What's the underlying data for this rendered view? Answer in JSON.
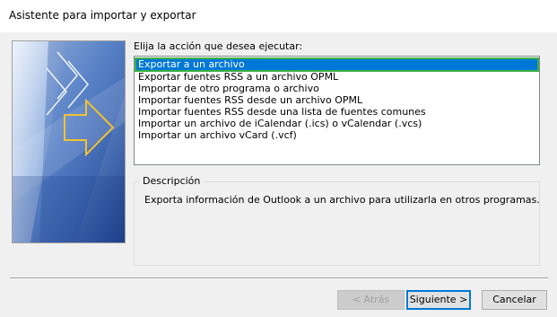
{
  "window": {
    "title": "Asistente para importar y exportar"
  },
  "prompt": "Elija la acción que desea ejecutar:",
  "actions": [
    {
      "label": "Exportar a un archivo",
      "selected": true
    },
    {
      "label": "Exportar fuentes RSS a un archivo OPML",
      "selected": false
    },
    {
      "label": "Importar de otro programa o archivo",
      "selected": false
    },
    {
      "label": "Importar fuentes RSS desde un archivo OPML",
      "selected": false
    },
    {
      "label": "Importar fuentes RSS desde una lista de fuentes comunes",
      "selected": false
    },
    {
      "label": "Importar un archivo de iCalendar (.ics) o vCalendar (.vcs)",
      "selected": false
    },
    {
      "label": "Importar un archivo vCard (.vcf)",
      "selected": false
    }
  ],
  "description": {
    "legend": "Descripción",
    "text": "Exporta información de Outlook a un archivo para utilizarla en otros programas."
  },
  "buttons": {
    "back": "< Atrás",
    "next": "Siguiente >",
    "cancel": "Cancelar"
  },
  "colors": {
    "selection": "#0078d7",
    "selection_outline": "#3cb043",
    "art_blue_dark": "#1d3f8a",
    "art_blue_light": "#6f98d6",
    "art_arrow": "#f1c232"
  }
}
